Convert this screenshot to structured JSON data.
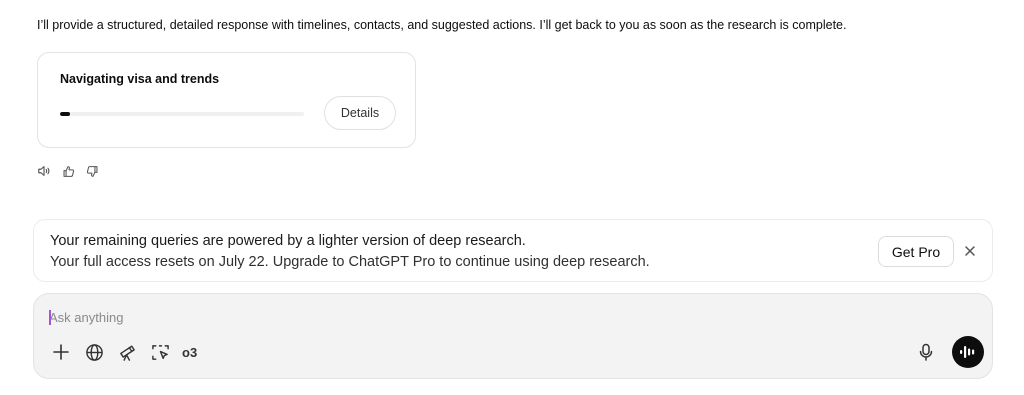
{
  "message": {
    "text": "I’ll provide a structured, detailed response with timelines, contacts, and suggested actions. I’ll get back to you as soon as the research is complete."
  },
  "research_card": {
    "title": "Navigating visa and trends",
    "progress": 0.04,
    "details_label": "Details"
  },
  "message_actions": [
    "read-aloud-icon",
    "thumbs-up-icon",
    "thumbs-down-icon"
  ],
  "banner": {
    "line1": "Your remaining queries are powered by a lighter version of deep research.",
    "line2": "Your full access resets on July 22. Upgrade to ChatGPT Pro to continue using deep research.",
    "cta_label": "Get Pro"
  },
  "composer": {
    "placeholder": "Ask anything",
    "value": "",
    "tools": [
      "plus-icon",
      "globe-icon",
      "telescope-icon",
      "select-region-icon"
    ],
    "model_label": "o3"
  },
  "colors": {
    "voice_button": "#0d0d0d",
    "composer_bg": "#f3f3f3",
    "caret": "#a057d8"
  }
}
